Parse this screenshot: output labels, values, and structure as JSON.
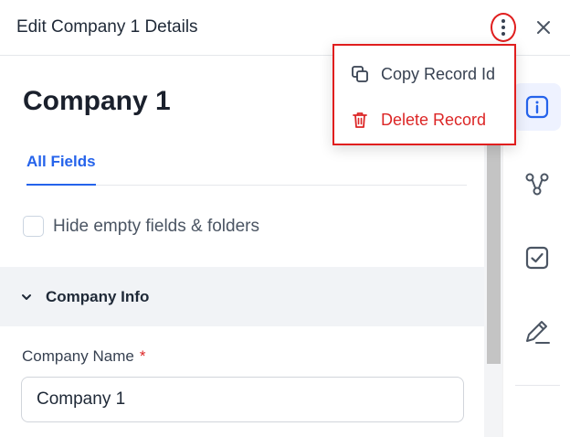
{
  "header": {
    "title": "Edit Company 1 Details",
    "more_icon": "more-vertical-icon",
    "close_icon": "close-icon"
  },
  "record": {
    "title": "Company 1"
  },
  "tabs": [
    {
      "label": "All Fields",
      "active": true
    }
  ],
  "filters": {
    "hide_empty_label": "Hide empty fields & folders",
    "hide_empty_checked": false
  },
  "section": {
    "label": "Company Info",
    "expanded": true
  },
  "fields": {
    "company_name": {
      "label": "Company Name",
      "required_marker": "*",
      "value": "Company 1"
    }
  },
  "menu": {
    "items": [
      {
        "label": "Copy Record Id",
        "icon": "copy-icon",
        "color": "#374151"
      },
      {
        "label": "Delete Record",
        "icon": "trash-icon",
        "color": "#dc2626"
      }
    ]
  },
  "rail": {
    "items": [
      {
        "icon": "info-icon",
        "active": true
      },
      {
        "icon": "associations-icon",
        "active": false
      },
      {
        "icon": "task-check-icon",
        "active": false
      },
      {
        "icon": "pen-icon",
        "active": false
      }
    ]
  },
  "colors": {
    "accent": "#2563eb",
    "danger": "#dc2626",
    "highlight_outline": "#e01e1e"
  }
}
